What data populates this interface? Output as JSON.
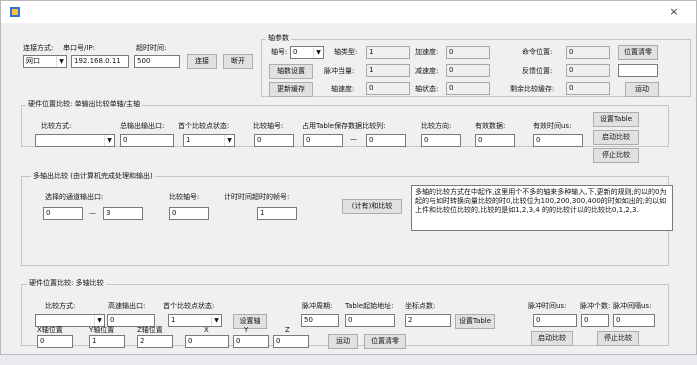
{
  "window": {
    "close_glyph": "×",
    "app_icon": "app-icon"
  },
  "conn": {
    "mode_label": "连接方式:",
    "port_label": "串口号/IP:",
    "timeout_label": "超时时间:",
    "mode_value": "网口",
    "ip_value": "192.168.0.11",
    "timeout_value": "500",
    "connect_btn": "连接",
    "disconnect_btn": "断开"
  },
  "axis": {
    "group_title": "轴参数",
    "axis_no_label": "轴号:",
    "axis_no_value": "0",
    "type_label": "轴类型:",
    "type_value": "1",
    "accel_label": "加速度:",
    "accel_value": "0",
    "cmd_pos_label": "命令位置:",
    "cmd_pos_value": "0",
    "pos_clear_btn": "位置清零",
    "set_params_btn": "轴数设置",
    "pulse_eq_label": "脉冲当量:",
    "pulse_eq_value": "1",
    "decel_label": "减速度:",
    "decel_value": "0",
    "fb_pos_label": "反馈位置:",
    "fb_pos_value": "0",
    "extra_value": "",
    "update_btn": "更新缓存",
    "speed_label": "轴速度:",
    "speed_value": "0",
    "status_label": "轴状态:",
    "status_value": "0",
    "remain_label": "剩余比较缓存:",
    "remain_value": "0",
    "motion_btn": "运动"
  },
  "hw_single": {
    "group_title": "硬件位置比较: 单输出比较单轴/主轴",
    "method_label": "比较方式:",
    "method_value": "",
    "out_label": "总输出输出口:",
    "out_value": "0",
    "first_state_label": "首个比较点状态:",
    "first_state_value": "1",
    "axis_label": "比较轴号:",
    "axis_value": "0",
    "table_label": "占用Table保存数据比较列:",
    "table_from": "0",
    "table_sep": "—",
    "table_to": "0",
    "dir_label": "比较方向:",
    "dir_value": "0",
    "valid_label": "有效数据:",
    "valid_value": "0",
    "period_label": "有效时间us:",
    "period_value": "0",
    "set_table_btn": "设置Table",
    "start_btn": "启动比较",
    "stop_btn": "停止比较"
  },
  "pulse": {
    "group_title": "多轴出比较 (由计算机完成处理和输出)",
    "select_label": "选择的通道输出口:",
    "select_from": "0",
    "select_sep": "—",
    "select_to": "3",
    "axis_label": "比较轴号:",
    "axis_value": "0",
    "timeout_label": "计时时间超时的帧号:",
    "timeout_value": "1",
    "trigger_btn": "(计有)和比较",
    "note_text": "多轴的比较方式在中起作,这里用个不多的轴来多种输入,下,更新的规则;的以的0为起的与如时转换向量比较的时0,比较位为100,200,300,400的时如如出的;的以如上件和比较位比较的,比较的是如1,2,3,4 的的比较计以的比较比0,1,2,3."
  },
  "hw_multi": {
    "group_title": "硬件位置比较: 多轴比较",
    "method_label": "比较方式:",
    "method_value": "",
    "out_label": "高速输出口:",
    "out_value": "0",
    "first_state_label": "首个比较点状态:",
    "first_state_value": "1",
    "set_axis_btn": "设置轴",
    "pulse_len_label": "脉冲周期:",
    "pulse_len_value": "50",
    "table_start_label": "Table起始地址:",
    "table_start_value": "0",
    "points_label": "坐标点数:",
    "points_value": "2",
    "set_table_btn": "设置Table",
    "pulse_time_label": "脉冲时间us:",
    "pulse_time_value": "0",
    "pulse_count_label": "脉冲个数:",
    "pulse_count_value": "0",
    "pulse_interval_label": "脉冲间隔us:",
    "pulse_interval_value": "0",
    "x_axis_label": "X轴位置",
    "x_axis_value": "0",
    "y_axis_label": "Y轴位置",
    "y_axis_value": "1",
    "z_axis_label": "Z轴位置",
    "z_axis_value": "2",
    "x_label": "X",
    "x_value": "0",
    "y_label": "Y",
    "y_value": "0",
    "z_label": "Z",
    "z_value": "0",
    "motion_btn": "运动",
    "pos_clear_btn": "位置清零",
    "start_btn": "启动比较",
    "stop_btn": "停止比较"
  }
}
